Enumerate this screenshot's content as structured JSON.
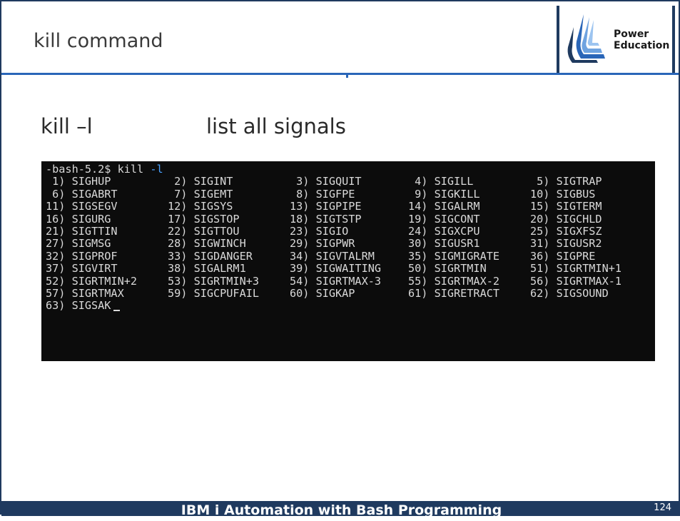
{
  "slide": {
    "title": "kill command",
    "logo_line1": "Power",
    "logo_line2": "Education",
    "command": "kill –l",
    "description": "list all signals"
  },
  "terminal": {
    "prompt": "-bash-5.2$ kill ",
    "flag": "-l",
    "signals": [
      " 1) SIGHUP",
      " 2) SIGINT",
      " 3) SIGQUIT",
      " 4) SIGILL",
      " 5) SIGTRAP",
      " 6) SIGABRT",
      " 7) SIGEMT",
      " 8) SIGFPE",
      " 9) SIGKILL",
      "10) SIGBUS",
      "11) SIGSEGV",
      "12) SIGSYS",
      "13) SIGPIPE",
      "14) SIGALRM",
      "15) SIGTERM",
      "16) SIGURG",
      "17) SIGSTOP",
      "18) SIGTSTP",
      "19) SIGCONT",
      "20) SIGCHLD",
      "21) SIGTTIN",
      "22) SIGTTOU",
      "23) SIGIO",
      "24) SIGXCPU",
      "25) SIGXFSZ",
      "27) SIGMSG",
      "28) SIGWINCH",
      "29) SIGPWR",
      "30) SIGUSR1",
      "31) SIGUSR2",
      "32) SIGPROF",
      "33) SIGDANGER",
      "34) SIGVTALRM",
      "35) SIGMIGRATE",
      "36) SIGPRE",
      "37) SIGVIRT",
      "38) SIGALRM1",
      "39) SIGWAITING",
      "50) SIGRTMIN",
      "51) SIGRTMIN+1",
      "52) SIGRTMIN+2",
      "53) SIGRTMIN+3",
      "54) SIGRTMAX-3",
      "55) SIGRTMAX-2",
      "56) SIGRTMAX-1",
      "57) SIGRTMAX",
      "59) SIGCPUFAIL",
      "60) SIGKAP",
      "61) SIGRETRACT",
      "62) SIGSOUND",
      "63) SIGSAK"
    ]
  },
  "footer": {
    "course_title": "IBM i Automation with Bash Programming",
    "page_number": "124"
  },
  "colors": {
    "accent_blue": "#2a66b8",
    "navy": "#1f3a5f",
    "terminal_bg": "#0c0c0c",
    "flag_color": "#4aa3ff"
  }
}
